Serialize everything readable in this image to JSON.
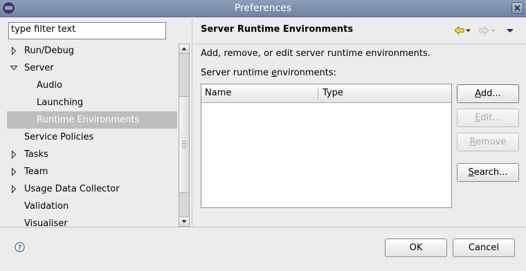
{
  "window": {
    "title": "Preferences"
  },
  "filter": {
    "placeholder": "type filter text",
    "value": "type filter text"
  },
  "tree": {
    "items": [
      {
        "label": "Run/Debug",
        "expander": "collapsed"
      },
      {
        "label": "Server",
        "expander": "expanded"
      },
      {
        "label": "Audio",
        "expander": "none"
      },
      {
        "label": "Launching",
        "expander": "none"
      },
      {
        "label": "Runtime Environments",
        "expander": "none",
        "selected": true
      },
      {
        "label": "Service Policies",
        "expander": "none"
      },
      {
        "label": "Tasks",
        "expander": "collapsed"
      },
      {
        "label": "Team",
        "expander": "collapsed"
      },
      {
        "label": "Usage Data Collector",
        "expander": "collapsed"
      },
      {
        "label": "Validation",
        "expander": "none"
      },
      {
        "label": "Visualiser",
        "expander": "none"
      }
    ]
  },
  "page": {
    "title": "Server Runtime Environments",
    "description": "Add, remove, or edit server runtime environments.",
    "env_label_pre": "Server runtime ",
    "env_label_mn": "e",
    "env_label_post": "nvironments:"
  },
  "table": {
    "columns": [
      "Name",
      "Type"
    ],
    "rows": []
  },
  "buttons": {
    "add": {
      "mnemonic": "A",
      "rest": "dd..."
    },
    "edit": {
      "mnemonic": "E",
      "rest": "dit..."
    },
    "remove": {
      "mnemonic": "R",
      "rest": "emove"
    },
    "search": {
      "mnemonic": "S",
      "rest": "earch..."
    },
    "ok": "OK",
    "cancel": "Cancel"
  },
  "colors": {
    "titlebar": "#7a8ca8",
    "selection": "#bdbdbd",
    "nav_arrow": "#c9a21a",
    "background": "#ececec"
  }
}
